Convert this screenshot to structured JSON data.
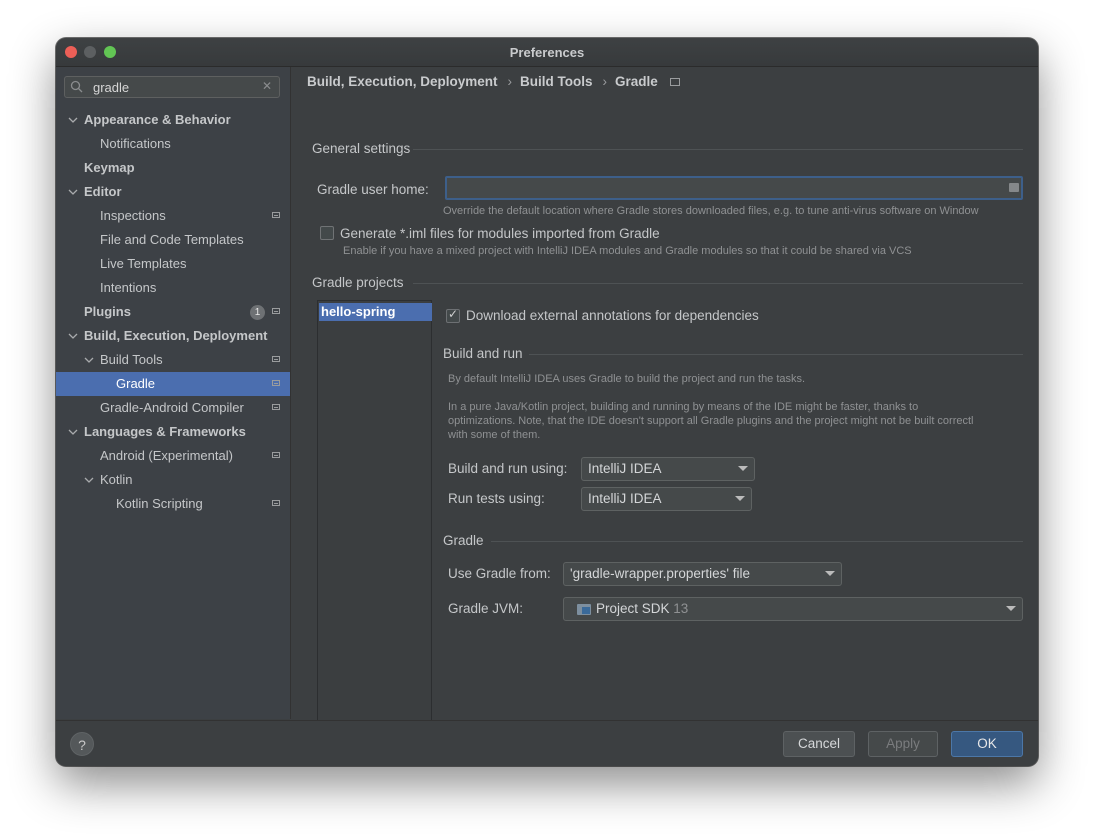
{
  "window": {
    "title": "Preferences"
  },
  "search": {
    "value": "gradle",
    "placeholder": ""
  },
  "sidebar": {
    "items": [
      {
        "label": "Appearance & Behavior",
        "level": 0,
        "expanded": true,
        "bold": true
      },
      {
        "label": "Notifications",
        "level": 1
      },
      {
        "label": "Keymap",
        "level": 0,
        "bold": true
      },
      {
        "label": "Editor",
        "level": 0,
        "expanded": true,
        "bold": true
      },
      {
        "label": "Inspections",
        "level": 1,
        "page_icon": true
      },
      {
        "label": "File and Code Templates",
        "level": 1
      },
      {
        "label": "Live Templates",
        "level": 1
      },
      {
        "label": "Intentions",
        "level": 1
      },
      {
        "label": "Plugins",
        "level": 0,
        "bold": true,
        "badge": "1",
        "page_icon": true
      },
      {
        "label": "Build, Execution, Deployment",
        "level": 0,
        "expanded": true,
        "bold": true
      },
      {
        "label": "Build Tools",
        "level": 1,
        "expanded": true,
        "page_icon": true
      },
      {
        "label": "Gradle",
        "level": 2,
        "selected": true,
        "page_icon": true
      },
      {
        "label": "Gradle-Android Compiler",
        "level": 1,
        "page_icon": true
      },
      {
        "label": "Languages & Frameworks",
        "level": 0,
        "expanded": true,
        "bold": true
      },
      {
        "label": "Android (Experimental)",
        "level": 1,
        "page_icon": true
      },
      {
        "label": "Kotlin",
        "level": 1,
        "expanded": true
      },
      {
        "label": "Kotlin Scripting",
        "level": 2,
        "page_icon": true
      }
    ]
  },
  "breadcrumb": [
    "Build, Execution, Deployment",
    "Build Tools",
    "Gradle"
  ],
  "general": {
    "title": "General settings",
    "user_home_label": "Gradle user home:",
    "user_home_value": "",
    "user_home_hint": "Override the default location where Gradle stores downloaded files, e.g. to tune anti-virus software on Window",
    "iml_label": "Generate *.iml files for modules imported from Gradle",
    "iml_checked": false,
    "iml_hint": "Enable if you have a mixed project with IntelliJ IDEA modules and Gradle modules so that it could be shared via VCS"
  },
  "projects": {
    "title": "Gradle projects",
    "list": [
      "hello-spring"
    ],
    "annotations_label": "Download external annotations for dependencies",
    "annotations_checked": true
  },
  "build_run": {
    "title": "Build and run",
    "hint1": "By default IntelliJ IDEA uses Gradle to build the project and run the tasks.",
    "hint2_line1": "In a pure Java/Kotlin project, building and running by means of the IDE might be faster, thanks to",
    "hint2_line2": "optimizations. Note, that the IDE doesn't support all Gradle plugins and the project might not be built correctl",
    "hint2_line3": "with some of them.",
    "using_label": "Build and run using:",
    "using_value": "IntelliJ IDEA",
    "tests_label": "Run tests using:",
    "tests_value": "IntelliJ IDEA"
  },
  "gradle": {
    "title": "Gradle",
    "from_label": "Use Gradle from:",
    "from_value": "'gradle-wrapper.properties' file",
    "jvm_label": "Gradle JVM:",
    "jvm_value": "Project SDK",
    "jvm_version": "13"
  },
  "footer": {
    "help": "?",
    "cancel": "Cancel",
    "apply": "Apply",
    "ok": "OK"
  },
  "colors": {
    "selection": "#4b6eaf",
    "primary_button": "#365880",
    "close": "#ec5f57",
    "maximize": "#62c554"
  }
}
